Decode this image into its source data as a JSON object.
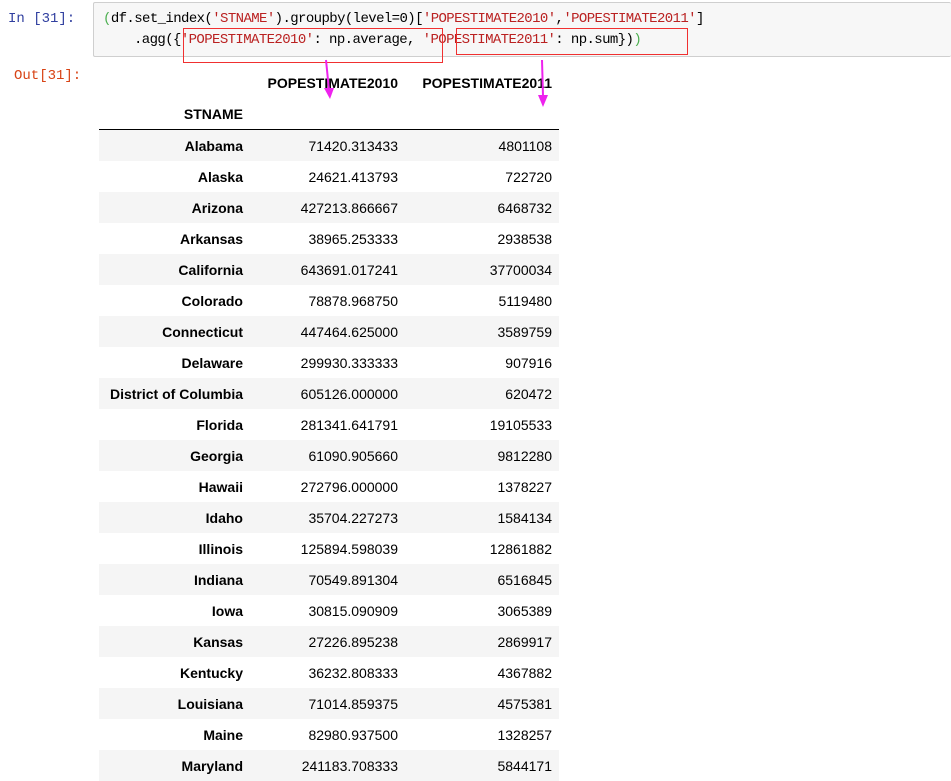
{
  "input_prompt": "In  [31]:",
  "output_prompt": "Out[31]:",
  "code": {
    "line1": [
      {
        "t": "(",
        "c": "paren"
      },
      {
        "t": "df.set_index(",
        "c": "kw"
      },
      {
        "t": "'STNAME'",
        "c": "str"
      },
      {
        "t": ").groupby(level=0)[",
        "c": "kw"
      },
      {
        "t": "'POPESTIMATE2010'",
        "c": "str"
      },
      {
        "t": ",",
        "c": "kw"
      },
      {
        "t": "'POPESTIMATE2011'",
        "c": "str"
      },
      {
        "t": "]",
        "c": "kw"
      }
    ],
    "line2": [
      {
        "t": ".agg({",
        "c": "kw"
      },
      {
        "t": "'POPESTIMATE2010'",
        "c": "str"
      },
      {
        "t": ": np.average, ",
        "c": "kw"
      },
      {
        "t": "'POPESTIMATE2011'",
        "c": "str"
      },
      {
        "t": ": np.sum})",
        "c": "kw"
      },
      {
        "t": ")",
        "c": "paren"
      }
    ]
  },
  "annotation_colors": {
    "box": "#f03030",
    "arrow": "#ee22ee"
  },
  "table": {
    "columns": [
      "POPESTIMATE2010",
      "POPESTIMATE2011"
    ],
    "index_name": "STNAME",
    "rows": [
      {
        "name": "Alabama",
        "v2010": "71420.313433",
        "v2011": "4801108"
      },
      {
        "name": "Alaska",
        "v2010": "24621.413793",
        "v2011": "722720"
      },
      {
        "name": "Arizona",
        "v2010": "427213.866667",
        "v2011": "6468732"
      },
      {
        "name": "Arkansas",
        "v2010": "38965.253333",
        "v2011": "2938538"
      },
      {
        "name": "California",
        "v2010": "643691.017241",
        "v2011": "37700034"
      },
      {
        "name": "Colorado",
        "v2010": "78878.968750",
        "v2011": "5119480"
      },
      {
        "name": "Connecticut",
        "v2010": "447464.625000",
        "v2011": "3589759"
      },
      {
        "name": "Delaware",
        "v2010": "299930.333333",
        "v2011": "907916"
      },
      {
        "name": "District of Columbia",
        "v2010": "605126.000000",
        "v2011": "620472"
      },
      {
        "name": "Florida",
        "v2010": "281341.641791",
        "v2011": "19105533"
      },
      {
        "name": "Georgia",
        "v2010": "61090.905660",
        "v2011": "9812280"
      },
      {
        "name": "Hawaii",
        "v2010": "272796.000000",
        "v2011": "1378227"
      },
      {
        "name": "Idaho",
        "v2010": "35704.227273",
        "v2011": "1584134"
      },
      {
        "name": "Illinois",
        "v2010": "125894.598039",
        "v2011": "12861882"
      },
      {
        "name": "Indiana",
        "v2010": "70549.891304",
        "v2011": "6516845"
      },
      {
        "name": "Iowa",
        "v2010": "30815.090909",
        "v2011": "3065389"
      },
      {
        "name": "Kansas",
        "v2010": "27226.895238",
        "v2011": "2869917"
      },
      {
        "name": "Kentucky",
        "v2010": "36232.808333",
        "v2011": "4367882"
      },
      {
        "name": "Louisiana",
        "v2010": "71014.859375",
        "v2011": "4575381"
      },
      {
        "name": "Maine",
        "v2010": "82980.937500",
        "v2011": "1328257"
      },
      {
        "name": "Maryland",
        "v2010": "241183.708333",
        "v2011": "5844171"
      }
    ]
  }
}
